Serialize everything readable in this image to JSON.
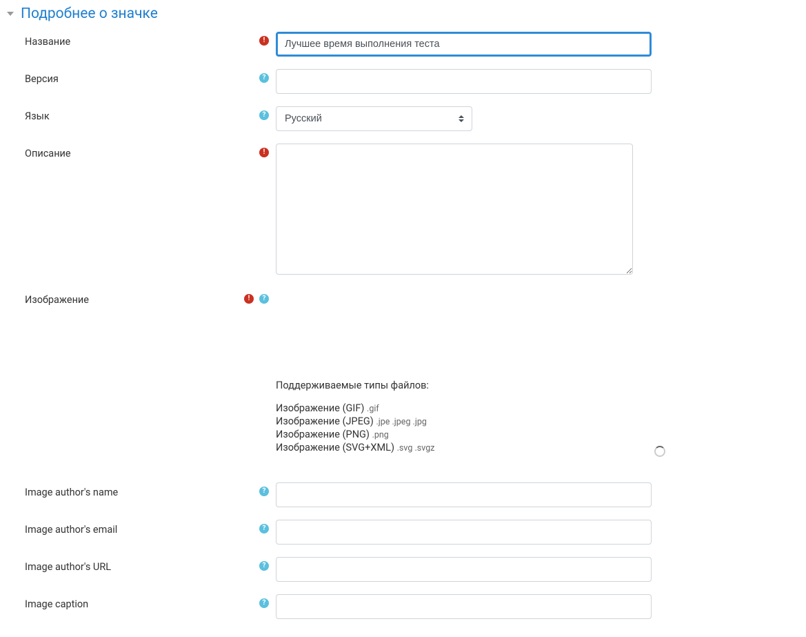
{
  "section": {
    "title": "Подробнее о значке"
  },
  "fields": {
    "name": {
      "label": "Название",
      "value": "Лучшее время выполнения теста"
    },
    "version": {
      "label": "Версия",
      "value": ""
    },
    "language": {
      "label": "Язык",
      "selected": "Русский"
    },
    "description": {
      "label": "Описание",
      "value": ""
    },
    "image": {
      "label": "Изображение"
    },
    "author_name": {
      "label": "Image author's name",
      "value": ""
    },
    "author_email": {
      "label": "Image author's email",
      "value": ""
    },
    "author_url": {
      "label": "Image author's URL",
      "value": ""
    },
    "caption": {
      "label": "Image caption",
      "value": ""
    }
  },
  "file_info": {
    "heading": "Поддерживаемые типы файлов:",
    "types": [
      {
        "label": "Изображение (GIF)",
        "ext": ".gif"
      },
      {
        "label": "Изображение (JPEG)",
        "ext": ".jpe .jpeg .jpg"
      },
      {
        "label": "Изображение (PNG)",
        "ext": ".png"
      },
      {
        "label": "Изображение (SVG+XML)",
        "ext": ".svg .svgz"
      }
    ]
  }
}
